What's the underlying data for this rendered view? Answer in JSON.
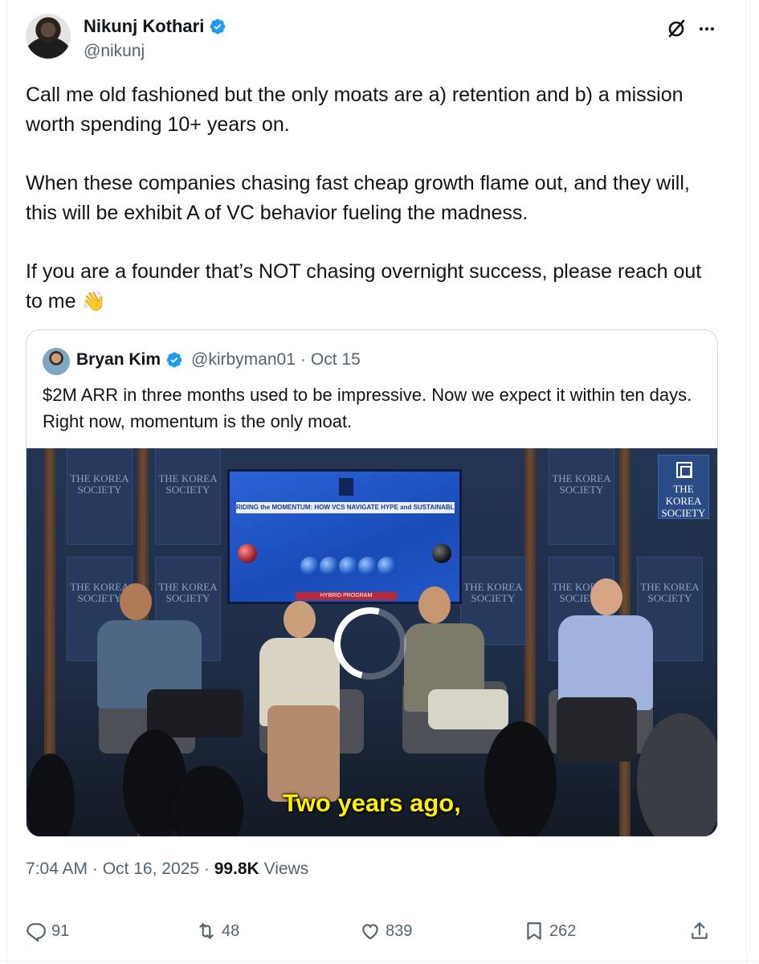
{
  "author": {
    "name": "Nikunj Kothari",
    "handle": "@nikunj",
    "verified_color": "#1d9bf0",
    "avatar_icon": "avatar-photo"
  },
  "tweet": {
    "paragraphs": [
      "Call me old fashioned but the only moats are a) retention and b) a mission worth spending 10+ years on.",
      "When these companies chasing fast cheap growth flame out, and they will, this will be exhibit A of VC behavior fueling the madness.",
      "If you are a founder that’s NOT chasing overnight success, please reach out to me"
    ],
    "emoji": "👋"
  },
  "quote": {
    "name": "Bryan Kim",
    "handle": "@kirbyman01",
    "separator": "·",
    "date": "Oct 15",
    "text": "$2M ARR in three months used to be impressive. Now we expect it within ten days. Right now, momentum is the only moat.",
    "video": {
      "caption": "Two years ago,",
      "screen_title": "RIDING the MOMENTUM: HOW VCS NAVIGATE HYPE and SUSTAINABLE GROWTH",
      "screen_program": "HYBRID PROGRAM",
      "panel_label": "THE KOREA SOCIETY",
      "logo_label": "THE KOREA SOCIETY"
    }
  },
  "meta": {
    "time": "7:04 AM",
    "dot1": "·",
    "date": "Oct 16, 2025",
    "dot2": "·",
    "views_count": "99.8K",
    "views_label": "Views"
  },
  "actions": {
    "replies": "91",
    "reposts": "48",
    "likes": "839",
    "bookmarks": "262"
  }
}
